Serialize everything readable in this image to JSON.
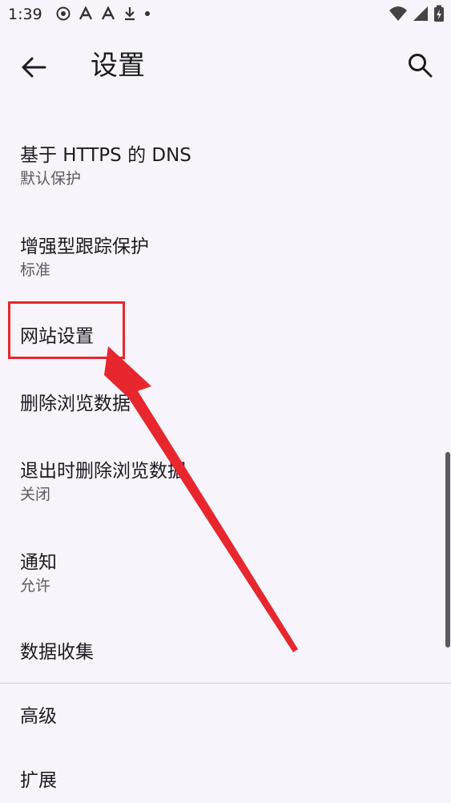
{
  "status_bar": {
    "time": "1:39",
    "left_icons": [
      "podcast-icon",
      "a-font-icon",
      "a-font-icon",
      "download-icon",
      "dot-icon"
    ],
    "right_icons": [
      "wifi-icon",
      "signal-icon",
      "battery-charging-icon"
    ]
  },
  "app_bar": {
    "title": "设置",
    "back_icon": "arrow-left-icon",
    "search_icon": "search-icon"
  },
  "settings": [
    {
      "title": "基于 HTTPS 的 DNS",
      "subtitle": "默认保护"
    },
    {
      "title": "增强型跟踪保护",
      "subtitle": "标准"
    },
    {
      "title": "网站设置",
      "subtitle": ""
    },
    {
      "title": "删除浏览数据",
      "subtitle": ""
    },
    {
      "title": "退出时删除浏览数据",
      "subtitle": "关闭"
    },
    {
      "title": "通知",
      "subtitle": "允许"
    },
    {
      "title": "数据收集",
      "subtitle": ""
    },
    {
      "title": "高级",
      "subtitle": ""
    },
    {
      "title": "扩展",
      "subtitle": ""
    }
  ],
  "annotation": {
    "color": "#e8262e",
    "target": "网站设置"
  },
  "colors": {
    "background": "#f7f5fb",
    "text_primary": "#1c1b20",
    "text_secondary": "#5d5a62",
    "divider": "#d3d0d8"
  }
}
